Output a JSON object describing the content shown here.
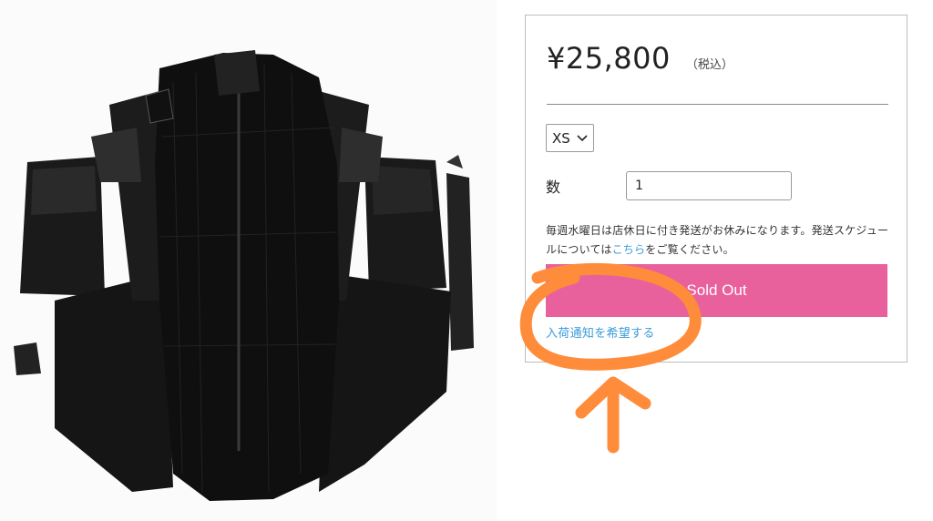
{
  "product": {
    "price": "¥25,800",
    "tax_note": "（税込）",
    "size_selected": "XS",
    "quantity_label": "数",
    "quantity_value": "1",
    "notice_text": "毎週水曜日は店休日に付き発送がお休みになります。発送スケジュールについては",
    "notice_link": "こちら",
    "notice_suffix": "をご覧ください。",
    "soldout_label": "Sold Out",
    "restock_link": "入荷通知を希望する"
  },
  "annotation": {
    "color": "#ff8c3a",
    "icons": [
      "circle-annotation",
      "arrow-up-annotation"
    ]
  },
  "colors": {
    "soldout_bg": "#e8609c",
    "link": "#3a9bd8"
  }
}
